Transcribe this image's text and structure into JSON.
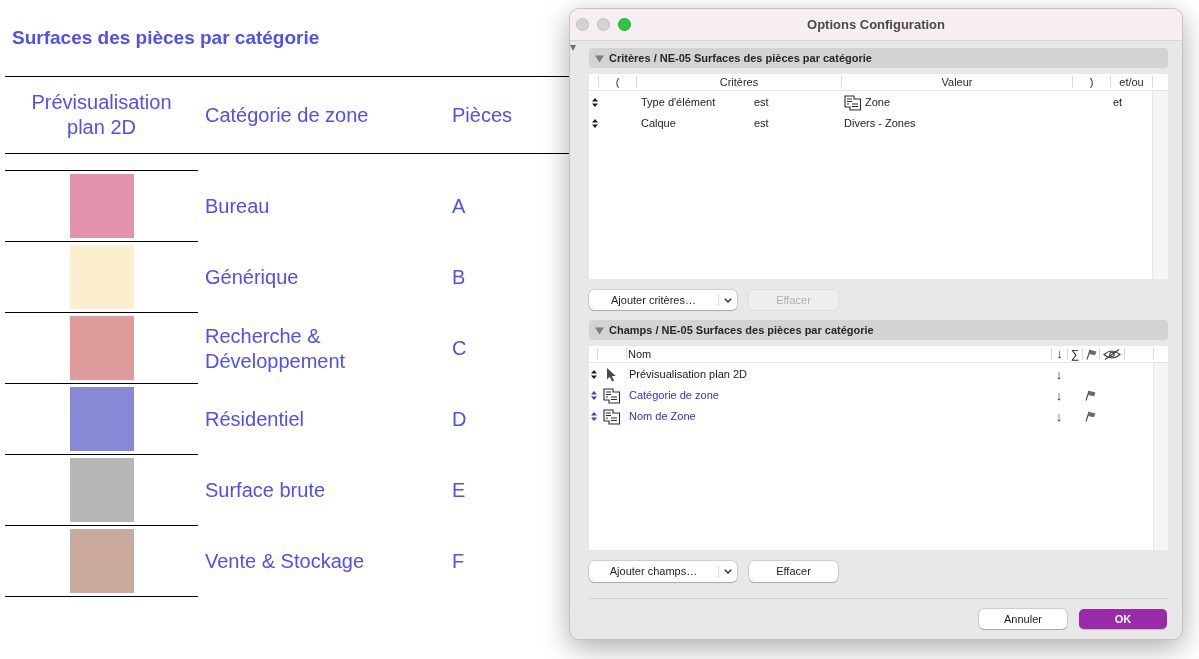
{
  "schedule": {
    "title": "Surfaces des pièces par catégorie",
    "columns": [
      "Prévisualisation plan 2D",
      "Catégorie de zone",
      "Pièces"
    ],
    "rows": [
      {
        "color": "#e393ae",
        "category": "Bureau",
        "room": "A"
      },
      {
        "color": "#fcefcf",
        "category": "Générique",
        "room": "B"
      },
      {
        "color": "#de9b9c",
        "category": "Recherche & Développement",
        "room": "C"
      },
      {
        "color": "#8889d6",
        "category": "Résidentiel",
        "room": "D"
      },
      {
        "color": "#b7b7b7",
        "category": "Surface brute",
        "room": "E"
      },
      {
        "color": "#cbaa9e",
        "category": "Vente & Stockage",
        "room": "F"
      }
    ]
  },
  "dialog": {
    "title": "Options Configuration",
    "window_controls": [
      {
        "kind": "close",
        "disabled": true
      },
      {
        "kind": "minimize",
        "disabled": true
      },
      {
        "kind": "zoom",
        "disabled": false
      }
    ],
    "criteria_section": {
      "heading": "Critères / NE-05 Surfaces des pièces par catégorie",
      "expanded": true,
      "columns": [
        "(",
        "Critères",
        "Valeur",
        ")",
        "et/ou"
      ],
      "rows": [
        {
          "kind": "zone",
          "criterion": "Type d'élément",
          "operator": "est",
          "value": "Zone",
          "conjunction": "et"
        },
        {
          "kind": "text",
          "criterion": "Calque",
          "operator": "est",
          "value": "Divers - Zones"
        }
      ],
      "buttons": [
        {
          "label": "Ajouter critères…",
          "kind": "split",
          "disabled": false
        },
        {
          "label": "Effacer",
          "kind": "plain",
          "disabled": true
        }
      ]
    },
    "fields_section": {
      "heading": "Champs / NE-05 Surfaces des pièces par catégorie",
      "expanded": true,
      "columns": [
        "Nom",
        "↓",
        "∑"
      ],
      "rows": [
        {
          "kind": "preview",
          "name": "Prévisualisation plan 2D",
          "sort": "↓",
          "flagged": false
        },
        {
          "kind": "zone",
          "name": "Catégorie de zone",
          "sort": "↓",
          "flagged": true
        },
        {
          "kind": "zone",
          "name": "Nom de Zone",
          "sort": "↓",
          "flagged": true
        }
      ],
      "buttons": [
        {
          "label": "Ajouter champs…",
          "kind": "split",
          "disabled": false
        },
        {
          "label": "Effacer",
          "kind": "plain",
          "disabled": false
        }
      ]
    },
    "footer_buttons": [
      {
        "label": "Annuler",
        "kind": "cancel"
      },
      {
        "label": "OK",
        "kind": "default"
      }
    ]
  }
}
